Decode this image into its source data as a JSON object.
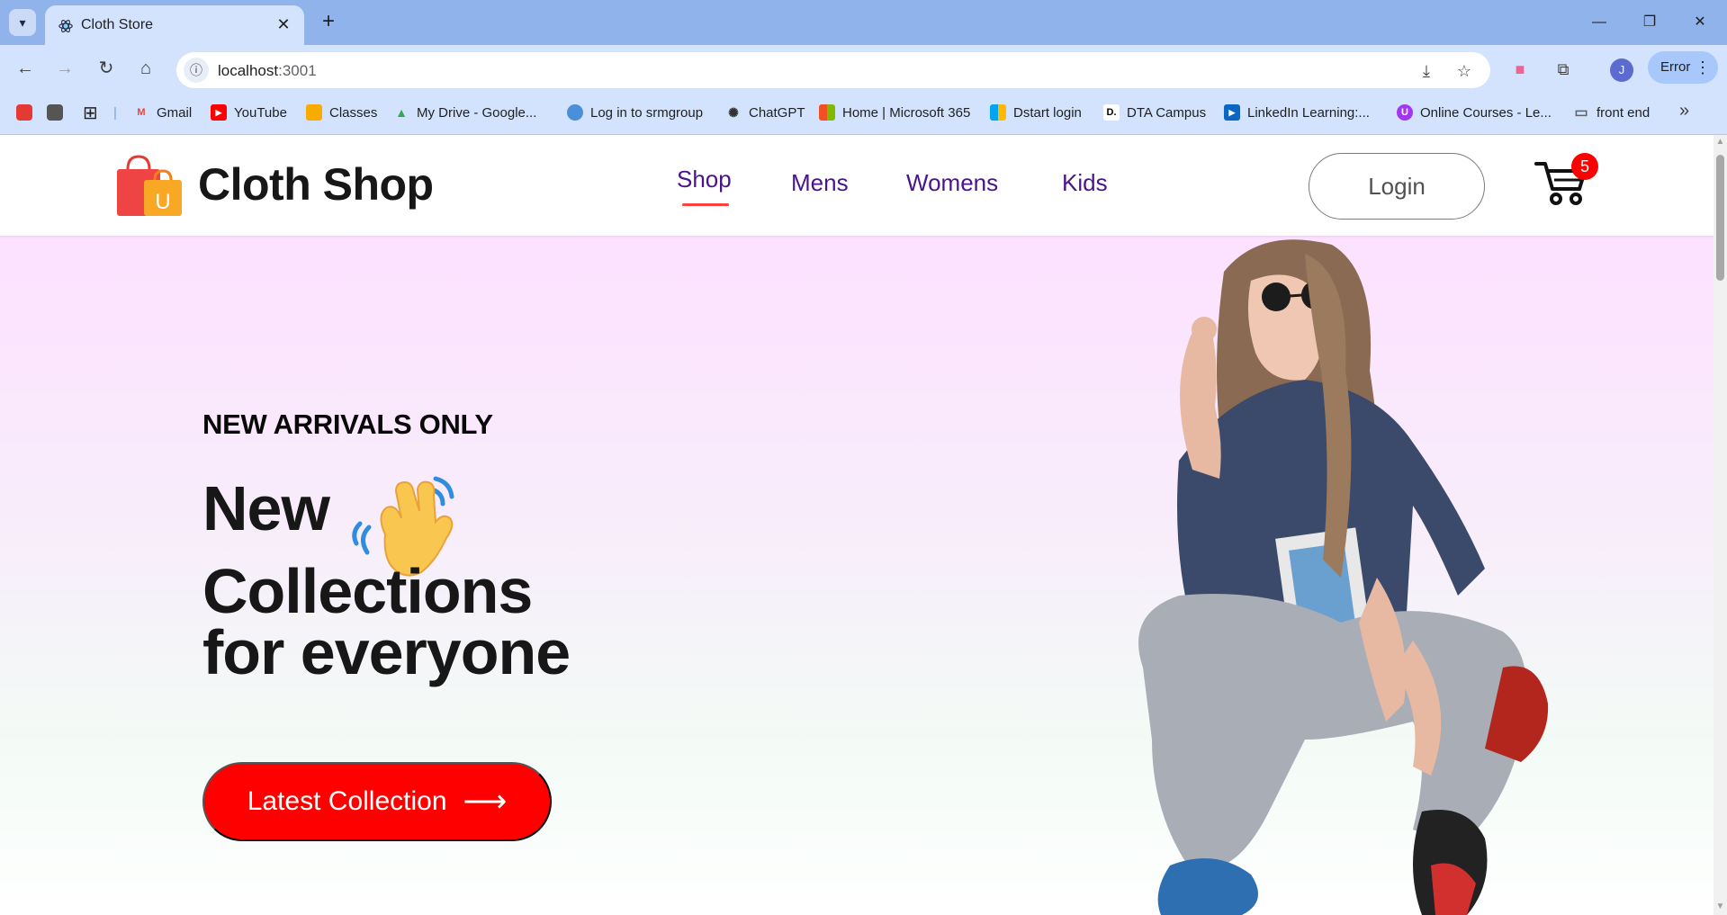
{
  "browser": {
    "tab_title": "Cloth Store",
    "url_host": "localhost",
    "url_port": ":3001",
    "error_label": "Error",
    "profile_initial": "J",
    "bookmarks": [
      {
        "label": "Gmail",
        "icon": "gmail-icon",
        "color": "#ea4335"
      },
      {
        "label": "YouTube",
        "icon": "youtube-icon",
        "color": "#ff0000"
      },
      {
        "label": "Classes",
        "icon": "classroom-icon",
        "color": "#f9ab00"
      },
      {
        "label": "My Drive - Google...",
        "icon": "drive-icon",
        "color": "#34a853"
      },
      {
        "label": "Log in to srmgroup",
        "icon": "srmgroup-icon",
        "color": "#4a8fd8"
      },
      {
        "label": "ChatGPT",
        "icon": "chatgpt-icon",
        "color": "#333333"
      },
      {
        "label": "Home | Microsoft 365",
        "icon": "microsoft-icon",
        "color": "#f25022"
      },
      {
        "label": "Dstart login",
        "icon": "microsoft-icon",
        "color": "#f25022"
      },
      {
        "label": "DTA Campus",
        "icon": "dta-icon",
        "color": "#000000"
      },
      {
        "label": "LinkedIn Learning:...",
        "icon": "linkedin-learning-icon",
        "color": "#0a66c2"
      },
      {
        "label": "Online Courses - Le...",
        "icon": "udemy-icon",
        "color": "#a435f0"
      },
      {
        "label": "front end",
        "icon": "folder-icon",
        "color": "#5f6368"
      }
    ]
  },
  "nav": {
    "brand": "Cloth Shop",
    "menu": [
      "Shop",
      "Mens",
      "Womens",
      "Kids"
    ],
    "active_menu": "Shop",
    "login_label": "Login",
    "cart_count": "5"
  },
  "hero": {
    "tag": "NEW ARRIVALS ONLY",
    "line1": "New",
    "line2": "Collections",
    "line3": "for everyone",
    "button_label": "Latest Collection",
    "button_arrow": "⟶"
  },
  "colors": {
    "accent": "#ff0000",
    "menu_text": "#4a148c",
    "hero_gradient_top": "#fde1ff"
  }
}
